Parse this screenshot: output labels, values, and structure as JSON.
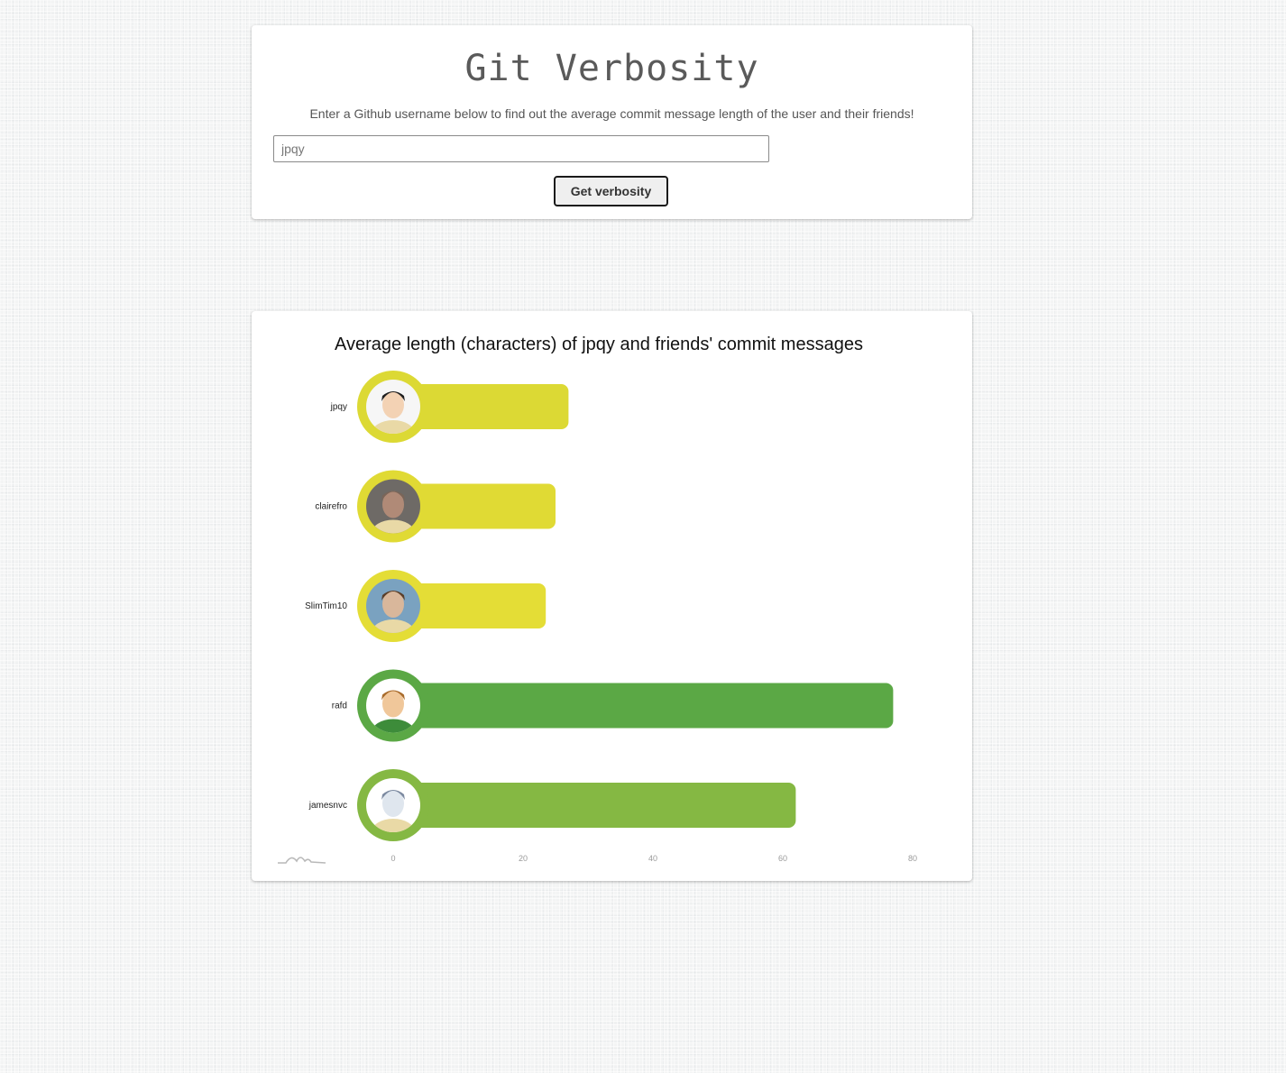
{
  "header": {
    "title": "Git Verbosity",
    "instructions": "Enter a Github username below to find out the average commit message length of the user and their friends!"
  },
  "search": {
    "value": "jpqy",
    "button_label": "Get verbosity"
  },
  "chart_data": {
    "type": "bar",
    "orientation": "horizontal",
    "title": "Average length (characters) of jpqy and friends' commit messages",
    "categories": [
      "jpqy",
      "clairefro",
      "SlimTim10",
      "rafd",
      "jamesnvc"
    ],
    "values": [
      27,
      25,
      23.5,
      77,
      62
    ],
    "colors": [
      "#dcd934",
      "#e0da34",
      "#e4dd36",
      "#5ba845",
      "#85b843"
    ],
    "xlim": [
      0,
      80
    ],
    "xticks": [
      "0",
      "20",
      "40",
      "60",
      "80"
    ],
    "xlabel": "",
    "ylabel": "",
    "grid": false,
    "legend": "none",
    "avatar_icons": [
      "avatar-jpqy-icon",
      "avatar-clairefro-icon",
      "avatar-slimtim10-icon",
      "avatar-rafd-icon",
      "avatar-jamesnvc-icon"
    ]
  }
}
